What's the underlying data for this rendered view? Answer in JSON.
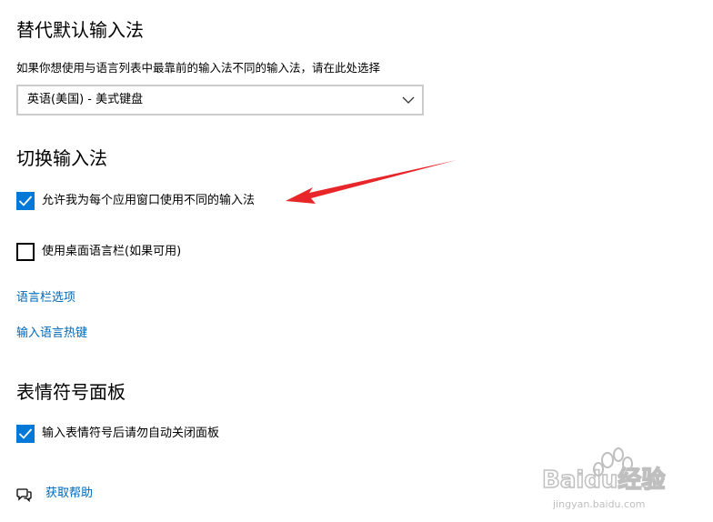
{
  "sections": {
    "default_input": {
      "title": "替代默认输入法",
      "description": "如果你想使用与语言列表中最靠前的输入法不同的输入法，请在此处选择",
      "dropdown_value": "英语(美国) - 美式键盘"
    },
    "switch_input": {
      "title": "切换输入法",
      "checkbox_per_app": {
        "label": "允许我为每个应用窗口使用不同的输入法",
        "checked": true
      },
      "checkbox_desktop_bar": {
        "label": "使用桌面语言栏(如果可用)",
        "checked": false
      },
      "link_language_bar": "语言栏选项",
      "link_hotkeys": "输入语言热键"
    },
    "emoji_panel": {
      "title": "表情符号面板",
      "checkbox_close": {
        "label": "输入表情符号后请勿自动关闭面板",
        "checked": true
      }
    }
  },
  "help": {
    "label": "获取帮助",
    "icon": "help-chat-icon"
  },
  "annotation": {
    "arrow_color": "#e8262a"
  },
  "watermark": {
    "brand": "Baidu经验",
    "url": "jingyan.baidu.com"
  },
  "colors": {
    "accent": "#0078d7",
    "link": "#0067b8"
  }
}
